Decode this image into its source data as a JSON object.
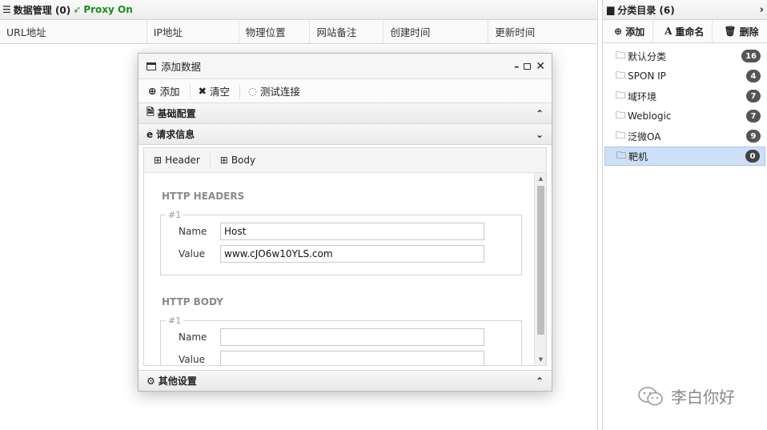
{
  "main": {
    "header_title": "数据管理 (0)",
    "proxy_status": "Proxy On",
    "columns": [
      "URL地址",
      "IP地址",
      "物理位置",
      "网站备注",
      "创建时间",
      "更新时间"
    ]
  },
  "sidebar": {
    "title": "分类目录 (6)",
    "toolbar": {
      "add": "添加",
      "rename": "重命名",
      "delete": "删除"
    },
    "categories": [
      {
        "name": "默认分类",
        "count": "16"
      },
      {
        "name": "SPON IP",
        "count": "4"
      },
      {
        "name": "域环境",
        "count": "7"
      },
      {
        "name": "Weblogic",
        "count": "7"
      },
      {
        "name": "泛微OA",
        "count": "9"
      },
      {
        "name": "靶机",
        "count": "0"
      }
    ]
  },
  "dialog": {
    "title": "添加数据",
    "toolbar": {
      "add": "添加",
      "clear": "清空",
      "test": "测试连接"
    },
    "sections": {
      "basic": "基础配置",
      "request": "请求信息",
      "other": "其他设置"
    },
    "tabs": {
      "header": "Header",
      "body": "Body"
    },
    "http_headers": {
      "title": "HTTP HEADERS",
      "legend": "#1",
      "name_label": "Name",
      "name_value": "Host",
      "value_label": "Value",
      "value_value": "www.cJO6w10YLS.com"
    },
    "http_body": {
      "title": "HTTP BODY",
      "legend": "#1",
      "name_label": "Name",
      "name_value": "",
      "value_label": "Value",
      "value_value": ""
    }
  },
  "watermark": "李白你好"
}
